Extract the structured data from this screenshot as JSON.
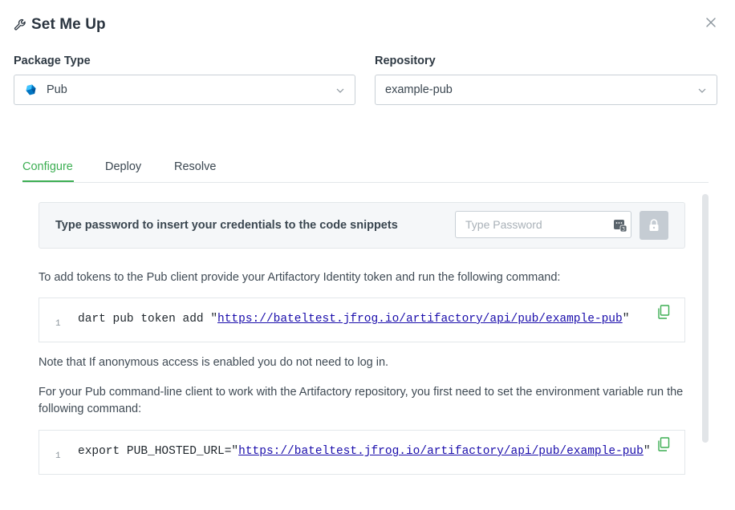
{
  "header": {
    "title": "Set Me Up"
  },
  "package_type": {
    "label": "Package Type",
    "value": "Pub"
  },
  "repository": {
    "label": "Repository",
    "value": "example-pub"
  },
  "tabs": [
    {
      "label": "Configure",
      "active": true
    },
    {
      "label": "Deploy",
      "active": false
    },
    {
      "label": "Resolve",
      "active": false
    }
  ],
  "credentials": {
    "text": "Type password to insert your credentials to the code snippets",
    "placeholder": "Type Password"
  },
  "content": {
    "p1": "To add tokens to the Pub client provide your Artifactory Identity token and run the following command:",
    "code1": {
      "line_no": "1",
      "prefix": "dart pub token add \"",
      "url": "https://bateltest.jfrog.io/artifactory/api/pub/example-pub",
      "suffix": "\""
    },
    "p2": "Note that If anonymous access is enabled you do not need to log in.",
    "p3": "For your Pub command-line client to work with the Artifactory repository, you first need to set the environment variable run the following command:",
    "code2": {
      "line_no": "1",
      "prefix": "export PUB_HOSTED_URL=\"",
      "url": "https://bateltest.jfrog.io/artifactory/api/pub/example-pub",
      "suffix": "\""
    }
  },
  "colors": {
    "accent": "#3cae52",
    "link": "#1a0dab"
  },
  "icons": [
    "wrench-icon",
    "close-icon",
    "pub-package-icon",
    "chevron-down-icon",
    "password-manager-icon",
    "lock-icon",
    "copy-icon"
  ]
}
